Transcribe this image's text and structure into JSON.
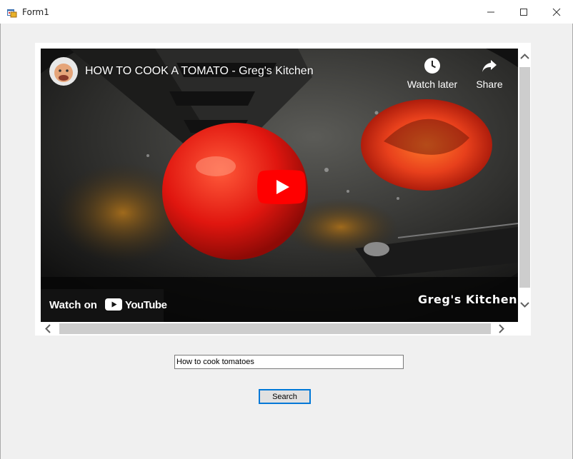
{
  "window": {
    "title": "Form1",
    "icon": "winforms-app-icon",
    "controls": [
      "minimize-icon",
      "maximize-icon",
      "close-icon"
    ]
  },
  "video": {
    "title": "HOW TO COOK A TOMATO - Greg's Kitchen",
    "channel_avatar": "channel-avatar",
    "watch_later_label": "Watch later",
    "share_label": "Share",
    "watch_on_label": "Watch on",
    "youtube_word": "YouTube",
    "watermark": "Greg's Kitchen",
    "play_icon": "play-icon",
    "colors": {
      "youtube_red": "#ff0000",
      "overlay": "#141414"
    }
  },
  "search": {
    "value": "How to cook tomatoes",
    "button_label": "Search"
  },
  "colors": {
    "form_background": "#f0f0f0",
    "focus_border": "#0078d7",
    "scrollbar_thumb": "#cdcdcd"
  }
}
